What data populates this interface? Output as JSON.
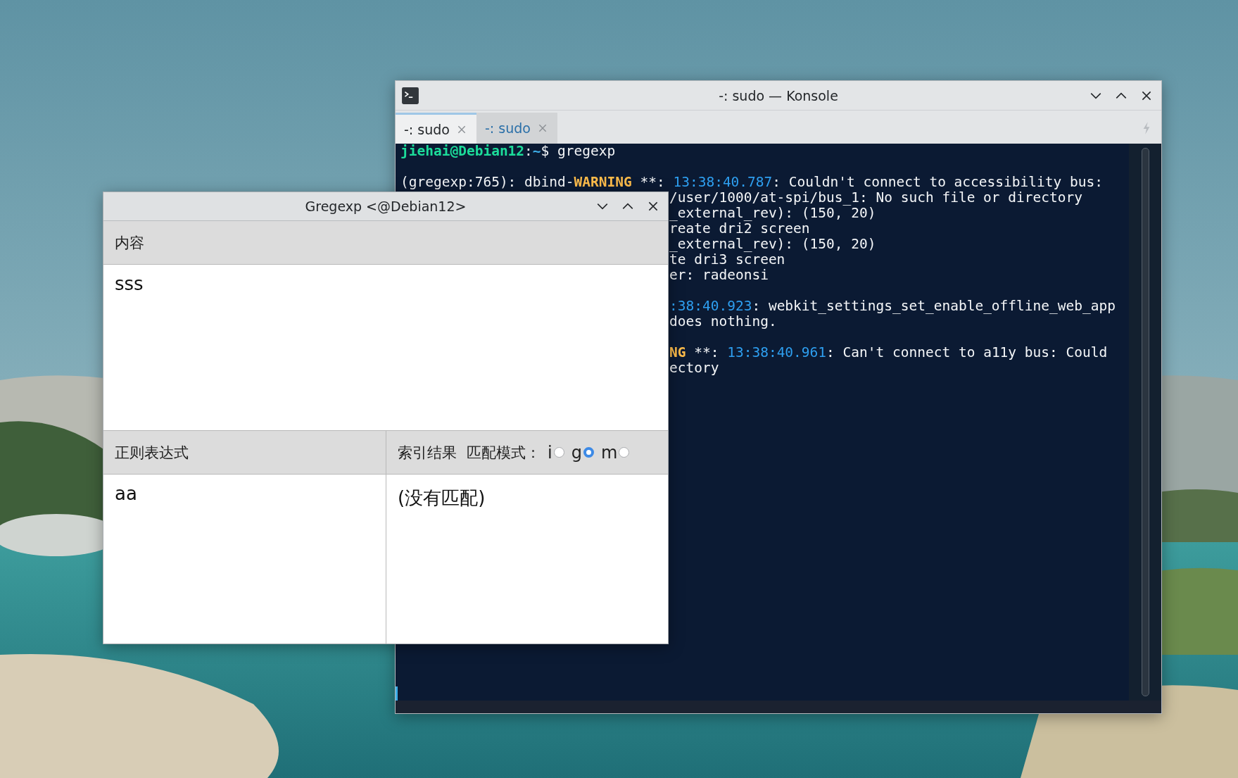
{
  "konsole": {
    "title": "-: sudo — Konsole",
    "tabs": [
      {
        "label": "-: sudo",
        "selected": true
      },
      {
        "label": "-: sudo",
        "selected": false
      }
    ],
    "lines": [
      {
        "kind": "full",
        "segments": [
          {
            "text": "jiehai@Debian12",
            "kind": "prompt"
          },
          {
            "text": ":",
            "kind": "plain"
          },
          {
            "text": "~",
            "kind": "path"
          },
          {
            "text": "$ gregexp",
            "kind": "plain"
          }
        ]
      },
      {
        "kind": "blank"
      },
      {
        "kind": "full",
        "segments": [
          {
            "text": "(gregexp:765): dbind-",
            "kind": "plain"
          },
          {
            "text": "WARNING",
            "kind": "warning"
          },
          {
            "text": " **: ",
            "kind": "plain"
          },
          {
            "text": "13:38:40.787",
            "kind": "time"
          },
          {
            "text": ": Couldn't connect to accessibility bus:",
            "kind": "plain"
          }
        ]
      },
      {
        "kind": "partial",
        "segments": [
          {
            "text": "/user/1000/at-spi/bus_1: No such file or directory",
            "kind": "plain"
          }
        ]
      },
      {
        "kind": "partial",
        "segments": [
          {
            "text": "_external_rev): (150, 20)",
            "kind": "plain"
          }
        ]
      },
      {
        "kind": "partial",
        "segments": [
          {
            "text": "reate dri2 screen",
            "kind": "plain"
          }
        ]
      },
      {
        "kind": "partial",
        "segments": [
          {
            "text": "_external_rev): (150, 20)",
            "kind": "plain"
          }
        ]
      },
      {
        "kind": "partial",
        "segments": [
          {
            "text": "te dri3 screen",
            "kind": "plain"
          }
        ]
      },
      {
        "kind": "partial",
        "segments": [
          {
            "text": "er: radeonsi",
            "kind": "plain"
          }
        ]
      },
      {
        "kind": "blank"
      },
      {
        "kind": "partial",
        "segments": [
          {
            "text": ":38:40.923",
            "kind": "time"
          },
          {
            "text": ": webkit_settings_set_enable_offline_web_app",
            "kind": "plain"
          }
        ]
      },
      {
        "kind": "partial",
        "segments": [
          {
            "text": "does nothing.",
            "kind": "plain"
          }
        ]
      },
      {
        "kind": "blank"
      },
      {
        "kind": "partial",
        "segments": [
          {
            "text": "NG",
            "kind": "warning"
          },
          {
            "text": " **: ",
            "kind": "plain"
          },
          {
            "text": "13:38:40.961",
            "kind": "time"
          },
          {
            "text": ": Can't connect to a11y bus: Could",
            "kind": "plain"
          }
        ]
      },
      {
        "kind": "partial",
        "segments": [
          {
            "text": "ectory",
            "kind": "plain"
          }
        ]
      }
    ]
  },
  "gregexp": {
    "title": "Gregexp <@Debian12>",
    "content": {
      "heading": "内容",
      "value": "sss"
    },
    "regex": {
      "heading": "正则表达式",
      "value": "aa"
    },
    "result": {
      "heading": "索引结果",
      "mode_label": "匹配模式：",
      "modes": [
        {
          "label": "i",
          "selected": false
        },
        {
          "label": "g",
          "selected": true
        },
        {
          "label": "m",
          "selected": false
        }
      ],
      "value": "(没有匹配)"
    }
  }
}
